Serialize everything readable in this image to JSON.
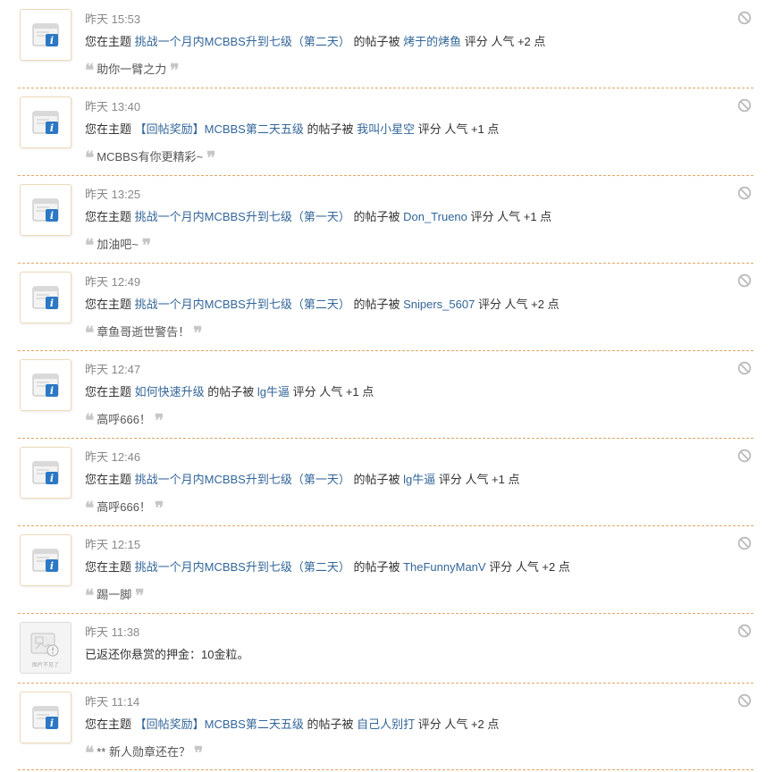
{
  "notices": [
    {
      "time": "昨天 15:53",
      "prefix": "您在主题 ",
      "topic": "挑战一个月内MCBBS升到七级（第二天）",
      "middle": " 的帖子被 ",
      "user": "烤于的烤鱼",
      "suffix": " 评分 人气 +2 点",
      "comment": "助你一臂之力"
    },
    {
      "time": "昨天 13:40",
      "prefix": "您在主题 ",
      "topic": "【回帖奖励】MCBBS第二天五级",
      "middle": " 的帖子被 ",
      "user": "我叫小星空",
      "suffix": " 评分 人气 +1 点",
      "comment": "MCBBS有你更精彩~"
    },
    {
      "time": "昨天 13:25",
      "prefix": "您在主题 ",
      "topic": "挑战一个月内MCBBS升到七级（第一天）",
      "middle": " 的帖子被 ",
      "user": "Don_Trueno",
      "suffix": " 评分 人气 +1 点",
      "comment": "加油吧~"
    },
    {
      "time": "昨天 12:49",
      "prefix": "您在主题 ",
      "topic": "挑战一个月内MCBBS升到七级（第二天）",
      "middle": " 的帖子被 ",
      "user": "Snipers_5607",
      "suffix": " 评分 人气 +2 点",
      "comment": "章鱼哥逝世警告！"
    },
    {
      "time": "昨天 12:47",
      "prefix": "您在主题 ",
      "topic": "如何快速升级",
      "middle": " 的帖子被 ",
      "user": "lg牛逼",
      "suffix": " 评分 人气 +1 点",
      "comment": "高呼666！"
    },
    {
      "time": "昨天 12:46",
      "prefix": "您在主题 ",
      "topic": "挑战一个月内MCBBS升到七级（第一天）",
      "middle": " 的帖子被 ",
      "user": "lg牛逼",
      "suffix": " 评分 人气 +1 点",
      "comment": "高呼666！"
    },
    {
      "time": "昨天 12:15",
      "prefix": "您在主题 ",
      "topic": "挑战一个月内MCBBS升到七级（第二天）",
      "middle": " 的帖子被 ",
      "user": "TheFunnyManV",
      "suffix": " 评分 人气 +2 点",
      "comment": "踢一脚"
    },
    {
      "time": "昨天 11:38",
      "system_text": "已返还你悬赏的押金：10金粒。",
      "system_avatar_label": "图片不见了"
    },
    {
      "time": "昨天 11:14",
      "prefix": "您在主题 ",
      "topic": "【回帖奖励】MCBBS第二天五级",
      "middle": " 的帖子被 ",
      "user": "自己人别打",
      "suffix": " 评分 人气 +2 点",
      "comment": "** 新人勋章还在？"
    }
  ],
  "quote_open": "❝",
  "quote_close": "❞",
  "icons": {
    "avatar": "notice-window-icon",
    "ignore": "ignore-circle-icon"
  },
  "colors": {
    "link": "#336699",
    "divider": "#e0a766",
    "time": "#888888"
  }
}
